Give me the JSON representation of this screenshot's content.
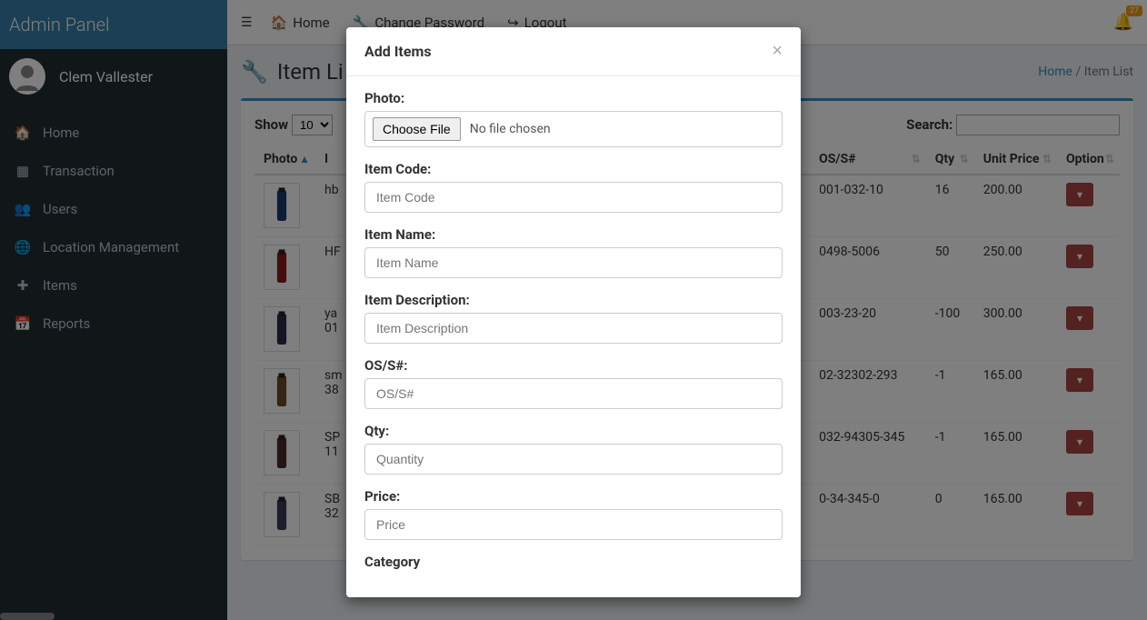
{
  "brand": "Admin Panel",
  "user": {
    "name": "Clem Vallester"
  },
  "sidebar": {
    "items": [
      {
        "icon": "home",
        "label": "Home"
      },
      {
        "icon": "th",
        "label": "Transaction"
      },
      {
        "icon": "users",
        "label": "Users"
      },
      {
        "icon": "globe",
        "label": "Location Management"
      },
      {
        "icon": "plus",
        "label": "Items"
      },
      {
        "icon": "calendar",
        "label": "Reports"
      }
    ]
  },
  "topbar": {
    "home": "Home",
    "change_password": "Change Password",
    "logout": "Logout",
    "notification_count": "27"
  },
  "page": {
    "title": "Item Li",
    "breadcrumb_home": "Home",
    "breadcrumb_current": "Item List"
  },
  "table": {
    "show_label": "Show",
    "show_value": "10",
    "search_label": "Search:",
    "headers": {
      "photo": "Photo",
      "item": "I",
      "os": "OS/S#",
      "qty": "Qty",
      "unit_price": "Unit Price",
      "option": "Option"
    },
    "rows": [
      {
        "item_prefix": "hb",
        "os": "001-032-10",
        "qty": "16",
        "price": "200.00"
      },
      {
        "item_prefix": "HF",
        "os": "0498-5006",
        "qty": "50",
        "price": "250.00"
      },
      {
        "item_prefix": "ya",
        "item_prefix2": "01",
        "os": "003-23-20",
        "qty": "-100",
        "price": "300.00"
      },
      {
        "item_prefix": "sm",
        "item_prefix2": "38",
        "os": "02-32302-293",
        "qty": "-1",
        "price": "165.00"
      },
      {
        "item_prefix": "SP",
        "item_prefix2": "11",
        "os": "032-94305-345",
        "qty": "-1",
        "price": "165.00"
      },
      {
        "item_prefix": "SB",
        "item_prefix2": "32",
        "os": "0-34-345-0",
        "qty": "0",
        "price": "165.00"
      }
    ]
  },
  "modal": {
    "title": "Add Items",
    "photo_label": "Photo:",
    "choose_file": "Choose File",
    "no_file": "No file chosen",
    "item_code_label": "Item Code:",
    "item_code_ph": "Item Code",
    "item_name_label": "Item Name:",
    "item_name_ph": "Item Name",
    "item_desc_label": "Item Description:",
    "item_desc_ph": "Item Description",
    "os_label": "OS/S#:",
    "os_ph": "OS/S#",
    "qty_label": "Qty:",
    "qty_ph": "Quantity",
    "price_label": "Price:",
    "price_ph": "Price",
    "category_label": "Category"
  }
}
